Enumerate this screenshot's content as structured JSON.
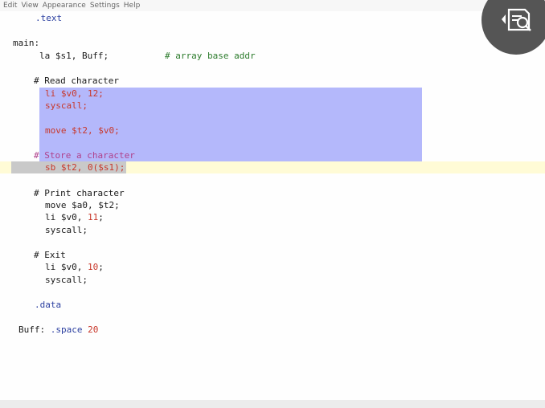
{
  "menubar": {
    "items": [
      "Edit",
      "View",
      "Appearance",
      "Settings",
      "Help"
    ]
  },
  "code": {
    "text_directive": ".text",
    "main_label": "main:",
    "la": "la $s1, Buff;",
    "la_comment": "# array base addr",
    "read_comment": "# Read character",
    "li_read": "li $v0, 12;",
    "syscall1": "syscall;",
    "move_t2": "move $t2, $v0;",
    "store_comment": "# Store a character",
    "sb_line": "sb $t2, 0($s1);",
    "print_comment": "# Print character",
    "move_a0": "move $a0, $t2;",
    "li_print_prefix": "li $v0, ",
    "li_print_num": "11",
    "li_print_suffix": ";",
    "syscall2": "syscall;",
    "exit_comment": "# Exit",
    "li_exit_prefix": "li $v0, ",
    "li_exit_num": "10",
    "li_exit_suffix": ";",
    "syscall3": "syscall;",
    "data_directive": ".data",
    "buff_label": "Buff:",
    "space_directive": ".space",
    "space_value": "20"
  },
  "colors": {
    "selection": "#b4b8fb",
    "current_line": "#fffbd6",
    "comment": "#2a7a2a",
    "directive": "#2b3fa0",
    "number": "#c8372a"
  },
  "icons": {
    "logo": "document-search-icon"
  }
}
